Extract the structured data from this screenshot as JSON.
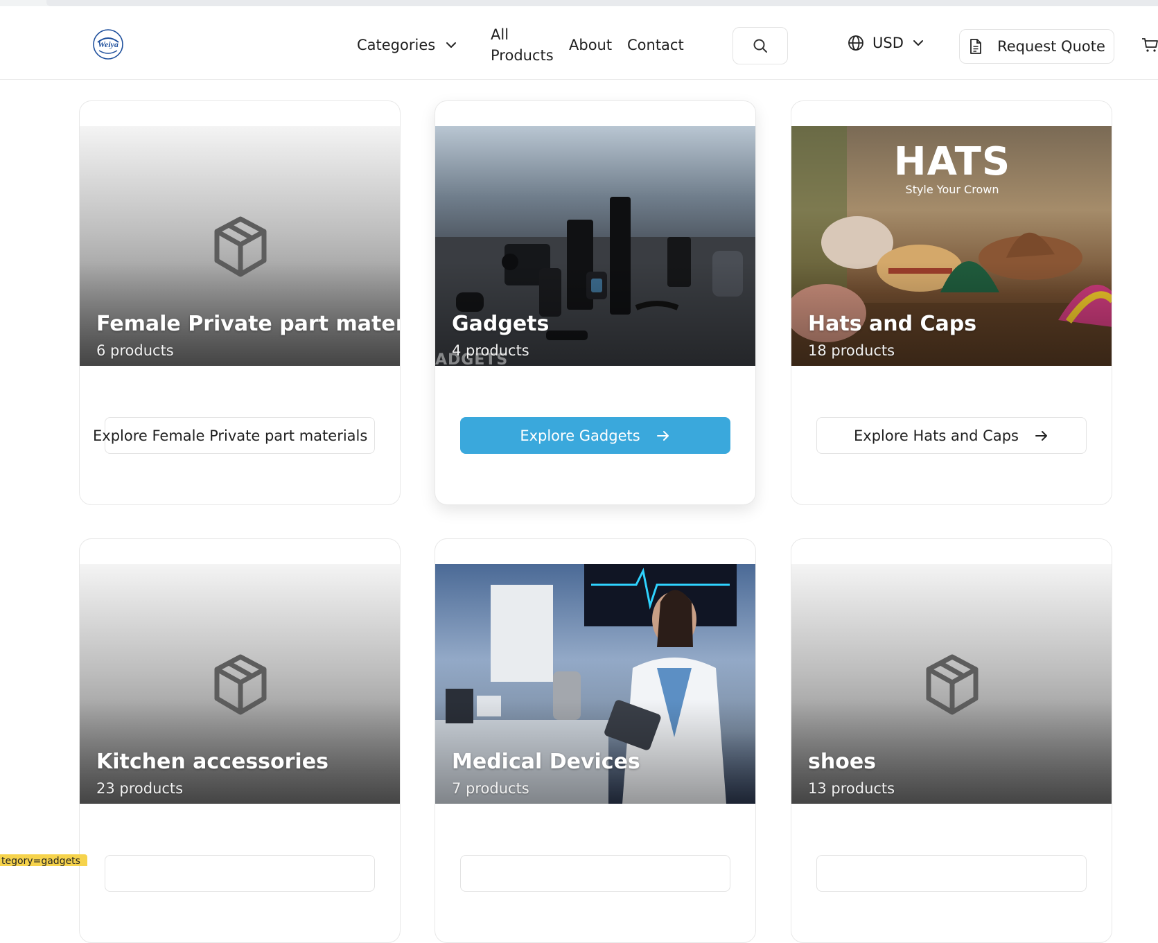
{
  "header": {
    "nav": {
      "categories": "Categories",
      "all_products_line1": "All",
      "all_products_line2": "Products",
      "about": "About",
      "contact": "Contact"
    },
    "currency": "USD",
    "request_quote": "Request Quote"
  },
  "cards": [
    {
      "title": "Female Private part materials",
      "count": "6 products",
      "button": "Explore Female Private part materials"
    },
    {
      "title": "Gadgets",
      "count": "4 products",
      "button": "Explore Gadgets",
      "image_text": "ADGETS"
    },
    {
      "title": "Hats and Caps",
      "count": "18 products",
      "button": "Explore Hats and Caps",
      "image_text": "HATS",
      "image_subtext": "Style Your Crown"
    },
    {
      "title": "Kitchen accessories",
      "count": "23 products"
    },
    {
      "title": "Medical Devices",
      "count": "7 products"
    },
    {
      "title": "shoes",
      "count": "13 products"
    }
  ],
  "status_url": "tegory=gadgets",
  "colors": {
    "accent": "#3aa8dc",
    "status_tip": "#f6d34c"
  }
}
